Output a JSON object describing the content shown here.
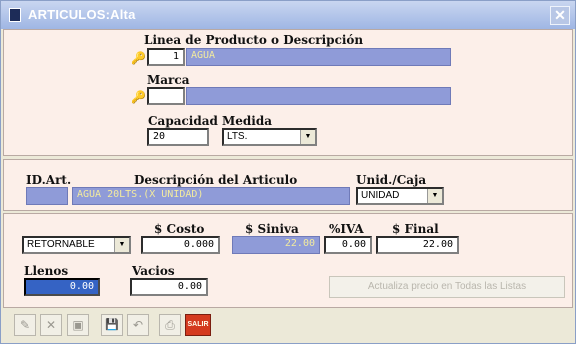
{
  "window": {
    "title": "ARTICULOS:Alta",
    "close_glyph": "✕"
  },
  "product": {
    "line_label": "Linea de Producto o Descripción",
    "line_code": "1",
    "line_desc": "AGUA",
    "brand_label": "Marca",
    "brand_code": "",
    "brand_desc": "",
    "capacity_label": "Capacidad",
    "capacity_value": "20",
    "measure_label": "Medida",
    "measure_value": "LTS."
  },
  "article": {
    "id_label": "ID.Art.",
    "id_value": "",
    "desc_label": "Descripción del Articulo",
    "desc_value": "AGUA 20LTS.(X UNIDAD)",
    "unit_label": "Unid./Caja",
    "unit_value": "UNIDAD"
  },
  "pricing": {
    "type_value": "RETORNABLE",
    "cost_label": "$ Costo",
    "cost_value": "0.000",
    "siniva_label": "$ Siniva",
    "siniva_value": "22.00",
    "iva_label": "%IVA",
    "iva_value": "0.00",
    "final_label": "$ Final",
    "final_value": "22.00",
    "llenos_label": "Llenos",
    "llenos_value": "0.00",
    "vacios_label": "Vacios",
    "vacios_value": "0.00",
    "update_button": "Actualiza precio en Todas las Listas"
  },
  "toolbar": {
    "edit": "✎",
    "delete": "✕",
    "clear": "▣",
    "save": "💾",
    "undo": "↶",
    "print": "⎙",
    "exit": "SALIR"
  },
  "colors": {
    "accent": "#8f9bd8",
    "panel": "#fcefe9",
    "title": "#9fb6e4"
  }
}
